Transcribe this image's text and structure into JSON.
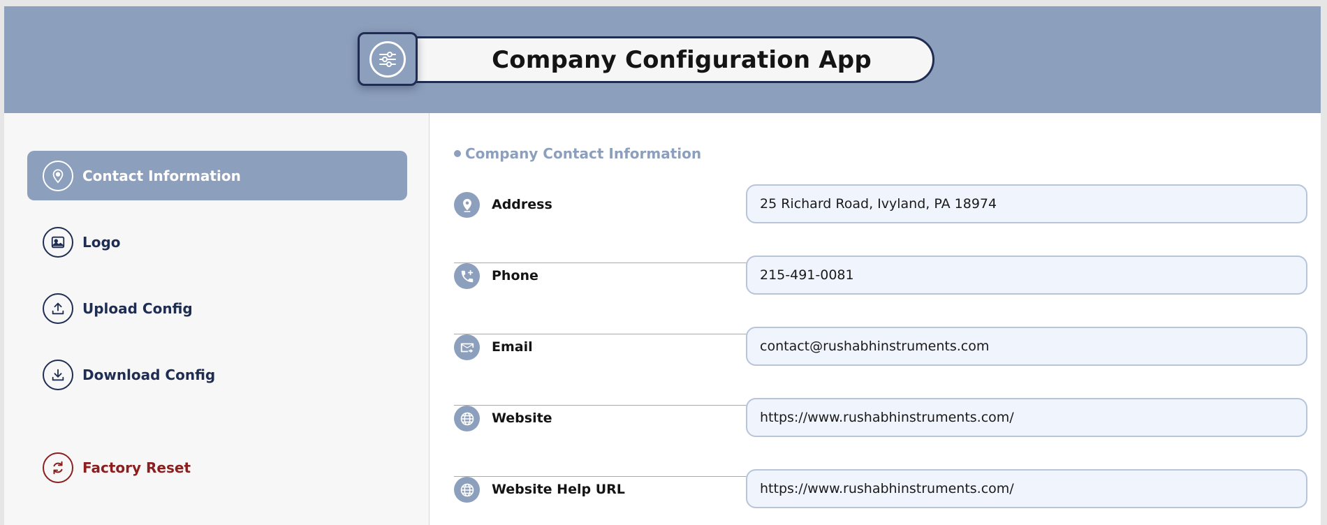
{
  "header": {
    "title": "Company Configuration App",
    "icon": "sliders-icon"
  },
  "sidebar": {
    "items": [
      {
        "label": "Contact Information",
        "icon": "location-pin-icon",
        "active": true
      },
      {
        "label": "Logo",
        "icon": "image-icon",
        "active": false
      },
      {
        "label": "Upload Config",
        "icon": "upload-icon",
        "active": false
      },
      {
        "label": "Download Config",
        "icon": "download-icon",
        "active": false
      },
      {
        "label": "Factory Reset",
        "icon": "refresh-icon",
        "active": false
      }
    ]
  },
  "main": {
    "section_title": "Company Contact Information",
    "fields": [
      {
        "label": "Address",
        "icon": "location-pin-icon",
        "value": "25 Richard Road, Ivyland, PA 18974"
      },
      {
        "label": "Phone",
        "icon": "phone-add-icon",
        "value": "215-491-0081"
      },
      {
        "label": "Email",
        "icon": "mail-forward-icon",
        "value": "contact@rushabhinstruments.com"
      },
      {
        "label": "Website",
        "icon": "globe-icon",
        "value": "https://www.rushabhinstruments.com/"
      },
      {
        "label": "Website Help URL",
        "icon": "globe-icon",
        "value": "https://www.rushabhinstruments.com/"
      }
    ]
  },
  "colors": {
    "accent": "#8c9fbc",
    "navy": "#1f2d52",
    "danger": "#8b1e1e",
    "input_bg": "#f0f4fc"
  }
}
